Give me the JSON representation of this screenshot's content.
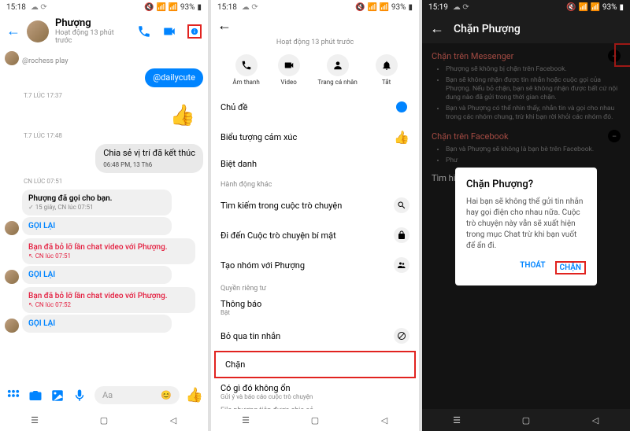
{
  "status": {
    "time1": "15:18",
    "time2": "15:18",
    "time3": "15:19",
    "battery1": "93%",
    "battery2": "93%",
    "battery3": "93%",
    "icons_left": "☁ ⟳",
    "icons_right": "📶 📶"
  },
  "p1": {
    "name": "Phượng",
    "activity": "Hoạt động 13 phút trước",
    "cut_msg": "@rochess play",
    "blue_msg": "@dailycute",
    "ts1": "T.7 LÚC 17:37",
    "ts2": "T.7 LÚC 17:48",
    "share_loc": "Chia sẻ vị trí đã kết thúc",
    "share_time": "06:48 PM, 13 Th6",
    "ts3": "CN LÚC 07:51",
    "called_you": "Phượng đã gọi cho bạn.",
    "called_sub": "✓ 15 giây, CN lúc 07:51",
    "call_back": "GỌI LẠI",
    "missed_video": "Bạn đã bỏ lỡ lần chat video với Phượng.",
    "missed_sub1": "↖ CN lúc 07:51",
    "missed_sub2": "↖ CN lúc 07:52",
    "input_placeholder": "Aa",
    "emoji": "😊"
  },
  "p2": {
    "activity": "Hoạt động 13 phút trước",
    "actions": {
      "audio": "Âm thanh",
      "video": "Video",
      "profile": "Trang cá nhân",
      "mute": "Tắt"
    },
    "items": {
      "theme": "Chủ đề",
      "emoji": "Biểu tượng cảm xúc",
      "nickname": "Biệt danh",
      "other_actions": "Hành động khác",
      "search": "Tìm kiếm trong cuộc trò chuyện",
      "secret": "Đi đến Cuộc trò chuyện bí mật",
      "group": "Tạo nhóm với Phượng",
      "privacy": "Quyền riêng tư",
      "notif": "Thông báo",
      "notif_sub": "Bật",
      "ignore": "Bỏ qua tin nhắn",
      "block": "Chặn",
      "wrong": "Có gì đó không ổn",
      "wrong_sub": "Gửi ý và báo cáo cuộc trò chuyện",
      "shared": "File phương tiện được chia sẻ"
    },
    "thumb": "👍"
  },
  "p3": {
    "title": "Chặn Phượng",
    "sec1_title": "Chặn trên Messenger",
    "bullets1": [
      "Phượng sẽ không bị chặn trên Facebook.",
      "Bạn sẽ không nhận được tin nhắn hoặc cuộc gọi của Phượng. Nếu bỏ chặn, bạn sẽ không nhận được bất cứ nội dung nào đã gửi trong thời gian chặn.",
      "Bạn và Phượng có thể nhìn thấy, nhắn tin và gọi cho nhau trong các nhóm chung, trừ khi bạn rời khỏi các nhóm đó."
    ],
    "sec2_title": "Chặn trên Facebook",
    "bullets2": [
      "Bạn và Phượng sẽ không là bạn bè trên Facebook.",
      "Phư"
    ],
    "tim": "Tìm hi",
    "dialog": {
      "title": "Chặn Phượng?",
      "body": "Hai bạn sẽ không thể gửi tin nhắn hay gọi điện cho nhau nữa. Cuộc trò chuyện này vẫn sẽ xuất hiện trong mục Chat trừ khi bạn vuốt để ẩn đi.",
      "cancel": "THOÁT",
      "block": "CHẶN"
    }
  }
}
